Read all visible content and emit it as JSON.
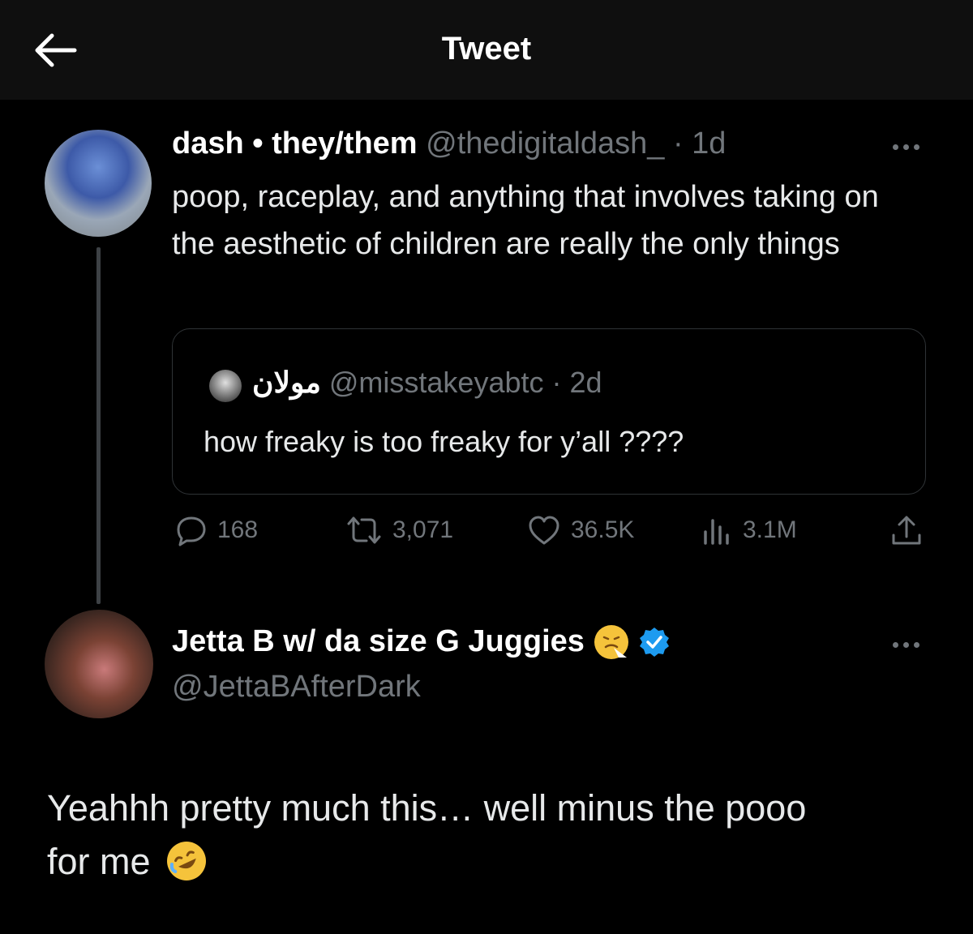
{
  "header": {
    "title": "Tweet",
    "back_icon": "arrow-left-icon"
  },
  "tweet1": {
    "name": "dash • they/them",
    "handle": "@thedigitaldash_",
    "time": "· 1d",
    "text": "poop, raceplay, and anything that involves taking on the aesthetic of children are really the only things",
    "quote": {
      "name": "مولان",
      "handle": "@misstakeyabtc",
      "time": "· 2d",
      "text": "how freaky is too freaky for y’all ????"
    },
    "stats": {
      "replies": "168",
      "retweets": "3,071",
      "likes": "36.5K",
      "views": "3.1M"
    }
  },
  "tweet2": {
    "name": "Jetta B w/ da size G Juggies",
    "handle": "@JettaBAfterDark",
    "text_line1": "Yeahhh pretty much this… well minus the pooo",
    "text_line2": "for me",
    "verified": true
  },
  "colors": {
    "background": "#000000",
    "muted": "#71767b",
    "verified": "#1d9bf0"
  }
}
